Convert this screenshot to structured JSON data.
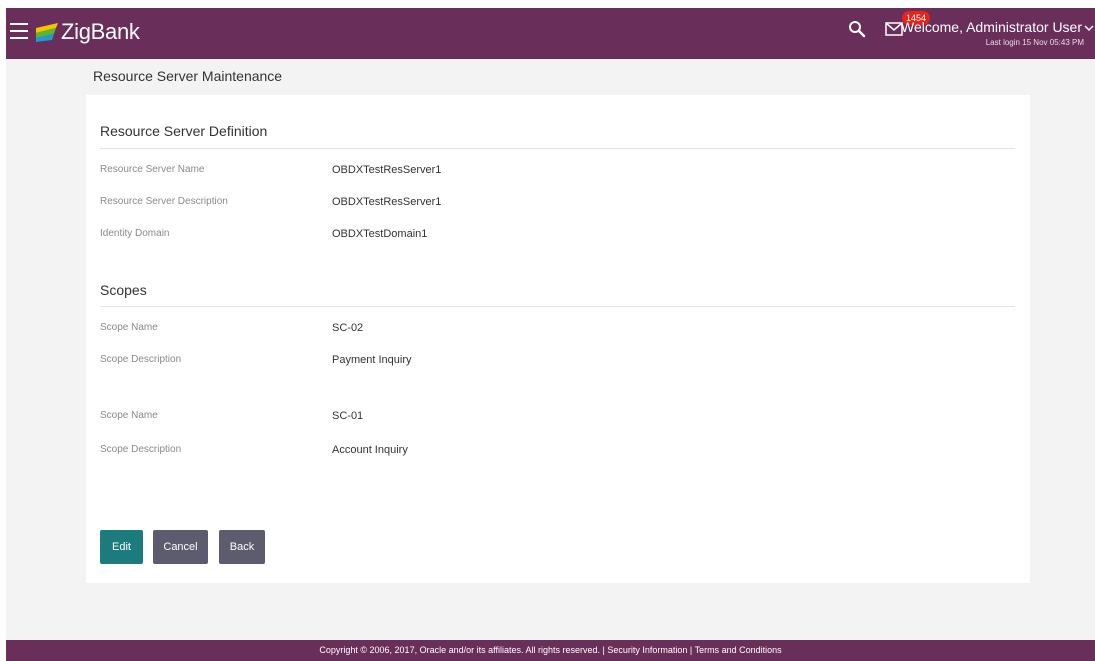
{
  "header": {
    "brand": "ZigBank",
    "notification_count": "1454",
    "welcome": "Welcome, Administrator User",
    "last_login": "Last login 15 Nov 05:43 PM",
    "icons": [
      "menu-icon",
      "zigbank-logo",
      "search-icon",
      "mail-icon",
      "chevron-down-icon"
    ],
    "colors": {
      "bar": "#6a2e5a",
      "badge": "#e8231b"
    }
  },
  "page": {
    "title": "Resource Server Maintenance"
  },
  "definition": {
    "title": "Resource Server Definition",
    "fields": [
      {
        "label": "Resource Server Name",
        "value": "OBDXTestResServer1"
      },
      {
        "label": "Resource Server Description",
        "value": "OBDXTestResServer1"
      },
      {
        "label": "Identity Domain",
        "value": "OBDXTestDomain1"
      }
    ]
  },
  "scopes": {
    "title": "Scopes",
    "items": [
      {
        "name_label": "Scope Name",
        "name": "SC-02",
        "desc_label": "Scope Description",
        "description": "Payment Inquiry"
      },
      {
        "name_label": "Scope Name",
        "name": "SC-01",
        "desc_label": "Scope Description",
        "description": "Account Inquiry"
      }
    ]
  },
  "actions": {
    "edit": "Edit",
    "cancel": "Cancel",
    "back": "Back",
    "colors": {
      "primary": "#1c7b7c",
      "secondary": "#5c5c6e"
    }
  },
  "footer": {
    "copyright": "Copyright © 2006, 2017, Oracle and/or its affiliates. All rights reserved.",
    "separator": " | ",
    "security_link": "Security Information",
    "terms_link": "Terms and Conditions"
  }
}
